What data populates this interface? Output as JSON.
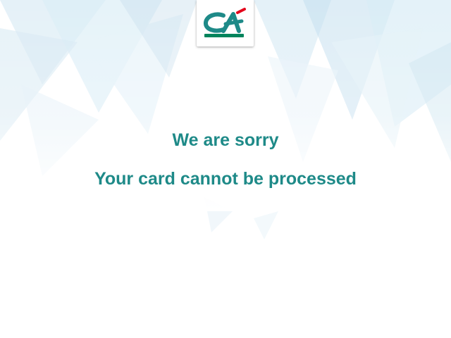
{
  "brand": {
    "logo_icon": "credit-agricole-logo-icon",
    "logo_letters": "CA",
    "colors": {
      "teal": "#1e8a88",
      "green": "#00845c",
      "red": "#e3051b"
    }
  },
  "message": {
    "title": "We are sorry",
    "body": "Your card cannot be processed"
  }
}
